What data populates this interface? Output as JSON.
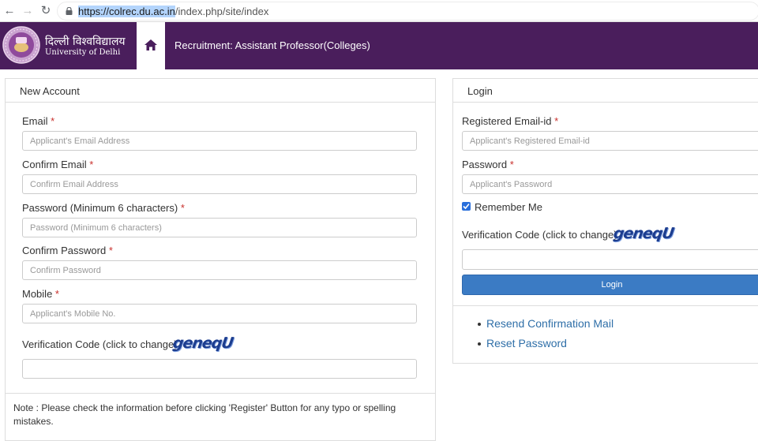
{
  "browser": {
    "url_host": "https://colrec.du.ac.in",
    "url_path": "/index.php/site/index"
  },
  "header": {
    "logo_hindi": "दिल्ली विश्वविद्यालय",
    "logo_english": "University of Delhi",
    "title": "Recruitment: Assistant Professor(Colleges)",
    "brand_color": "#4a1e5c"
  },
  "new_account": {
    "title": "New Account",
    "fields": [
      {
        "label": "Email",
        "placeholder": "Applicant's Email Address"
      },
      {
        "label": "Confirm Email",
        "placeholder": "Confirm Email Address"
      },
      {
        "label": "Password (Minimum 6 characters)",
        "placeholder": "Password (Minimum 6 characters)"
      },
      {
        "label": "Confirm Password",
        "placeholder": "Confirm Password"
      },
      {
        "label": "Mobile",
        "placeholder": "Applicant's Mobile No."
      }
    ],
    "verification_label": "Verification Code (click to change)",
    "captcha_text": "geneqU",
    "note": "Note : Please check the information before clicking 'Register' Button for any typo or spelling mistakes."
  },
  "login": {
    "title": "Login",
    "email_label": "Registered Email-id",
    "email_placeholder": "Applicant's Registered Email-id",
    "password_label": "Password",
    "password_placeholder": "Applicant's Password",
    "remember_label": "Remember Me",
    "remember_checked": true,
    "verification_label": "Verification Code (click to change)",
    "captcha_text": "geneqU",
    "button_label": "Login",
    "links": [
      "Resend Confirmation Mail",
      "Reset Password"
    ]
  },
  "required_mark": "*"
}
